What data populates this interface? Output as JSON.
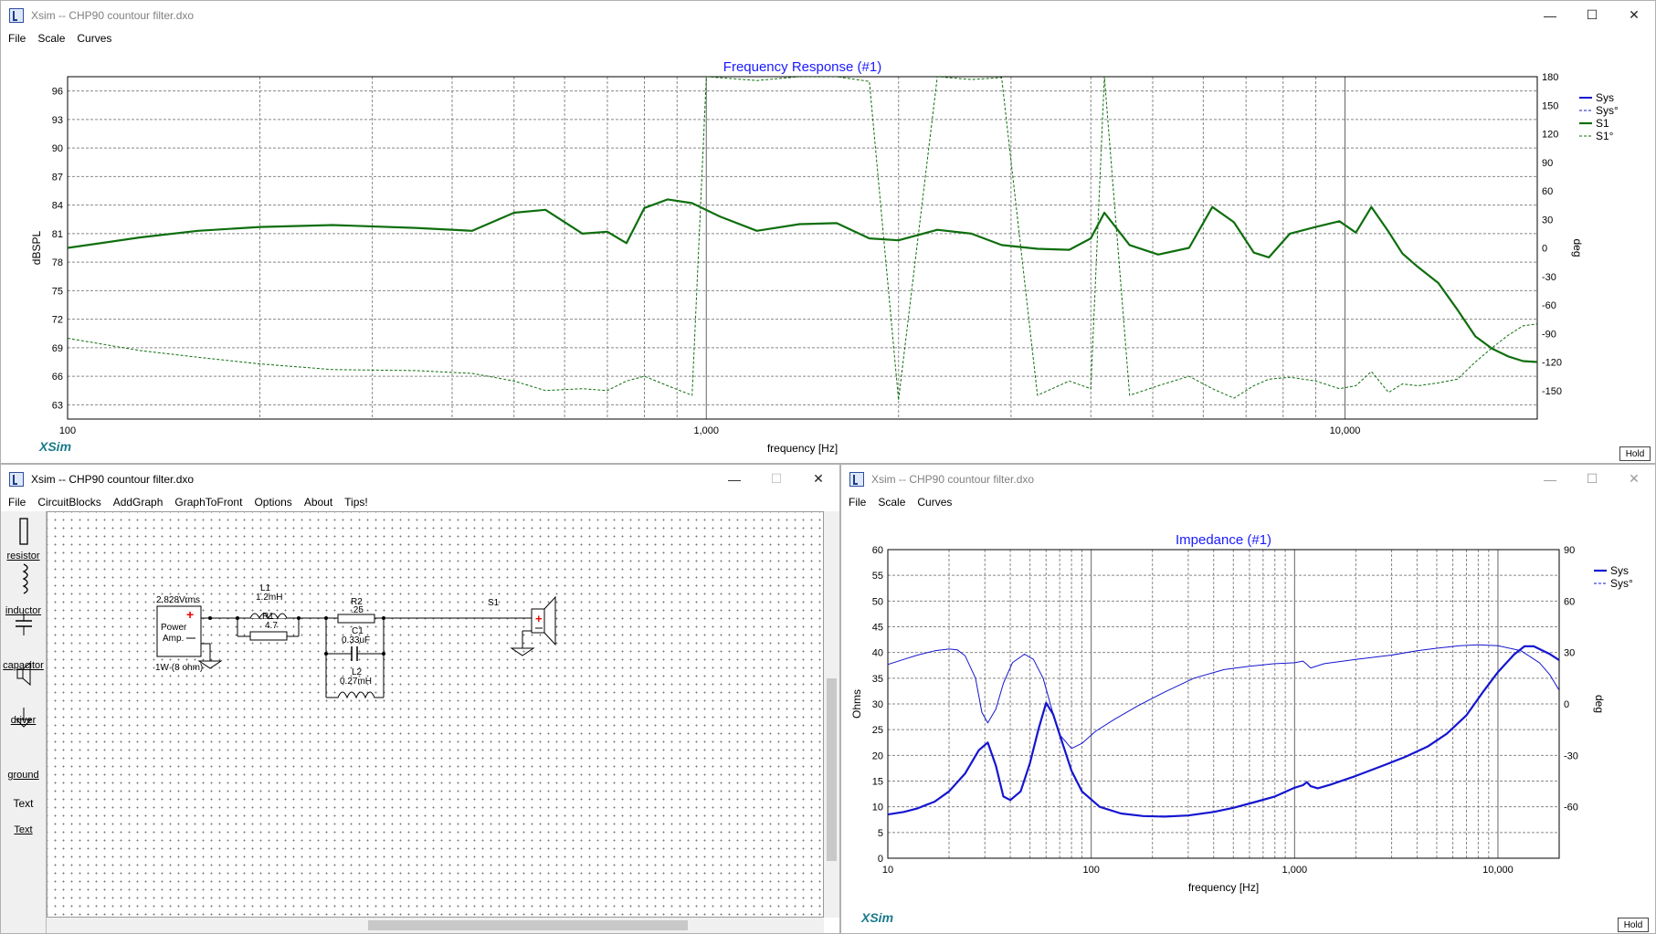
{
  "freq_window": {
    "title": "Xsim -- CHP90 countour filter.dxo",
    "menu": [
      "File",
      "Scale",
      "Curves"
    ],
    "controls": {
      "minimize": "—",
      "maximize": "☐",
      "close": "✕"
    },
    "graph_title": "Frequency Response (#1)",
    "logo": "XSim",
    "hold": "Hold"
  },
  "circuit_window": {
    "title": "Xsim -- CHP90 countour filter.dxo",
    "menu": [
      "File",
      "CircuitBlocks",
      "AddGraph",
      "GraphToFront",
      "Options",
      "About",
      "Tips!"
    ],
    "controls": {
      "minimize": "—",
      "maximize": "☐",
      "close": "✕"
    },
    "tools": [
      "resistor",
      "inductor",
      "capacitor",
      "driver",
      "ground",
      "Text",
      "Text"
    ],
    "components": {
      "source_voltage": "2.828Vrms",
      "source_label_1": "Power",
      "source_label_2": "Amp.",
      "source_power": "1W (8 ohm)",
      "l1_name": "L1",
      "l1_value": "1.2mH",
      "r1_name": "R1",
      "r1_value": "4.7",
      "r2_name": "R2",
      "r2_value": ".25",
      "c1_name": "C1",
      "c1_value": "0.33uF",
      "l2_name": "L2",
      "l2_value": "0.27mH",
      "driver_name": "S1"
    }
  },
  "imp_window": {
    "title": "Xsim -- CHP90 countour filter.dxo",
    "menu": [
      "File",
      "Scale",
      "Curves"
    ],
    "controls": {
      "minimize": "—",
      "maximize": "☐",
      "close": "✕"
    },
    "graph_title": "Impedance (#1)",
    "logo": "XSim",
    "hold": "Hold"
  },
  "colors": {
    "sys": "#1515d0",
    "s1": "#0e6e0e",
    "title": "#1a1aff",
    "logo": "#1a7a8c"
  },
  "chart_data": [
    {
      "type": "line",
      "title": "Frequency Response (#1)",
      "xlabel": "frequency [Hz]",
      "ylabel": "dBSPL",
      "y2label": "deg",
      "xscale": "log",
      "xlim": [
        100,
        20000
      ],
      "ylim": [
        61.5,
        97.5
      ],
      "y2lim": [
        -180,
        180
      ],
      "x_tick_labels": [
        "100",
        "1,000",
        "10,000"
      ],
      "y_ticks": [
        63,
        66,
        69,
        72,
        75,
        78,
        81,
        84,
        87,
        90,
        93,
        96
      ],
      "y2_ticks": [
        -150,
        -120,
        -90,
        -60,
        -30,
        0,
        30,
        60,
        90,
        120,
        150,
        180
      ],
      "grid": true,
      "legend": {
        "position": "right",
        "entries": [
          "Sys",
          "Sys°",
          "S1",
          "S1°"
        ]
      },
      "series": [
        {
          "name": "S1",
          "axis": "left",
          "style": "solid",
          "x": [
            100,
            130,
            160,
            200,
            260,
            350,
            430,
            500,
            560,
            640,
            700,
            750,
            800,
            870,
            950,
            1050,
            1200,
            1400,
            1600,
            1800,
            2000,
            2300,
            2600,
            2900,
            3300,
            3700,
            4000,
            4200,
            4600,
            5100,
            5700,
            6200,
            6700,
            7200,
            7600,
            8200,
            9000,
            9800,
            10400,
            11000,
            11700,
            12300,
            13000,
            14000,
            15000,
            16000,
            17000,
            18000,
            19000,
            20000
          ],
          "y": [
            79.5,
            80.6,
            81.3,
            81.7,
            81.9,
            81.6,
            81.3,
            83.2,
            83.5,
            81.0,
            81.2,
            80.0,
            83.7,
            84.6,
            84.2,
            82.8,
            81.3,
            82.0,
            82.1,
            80.5,
            80.3,
            81.4,
            81.0,
            79.8,
            79.4,
            79.3,
            80.5,
            83.2,
            79.8,
            78.8,
            79.5,
            83.8,
            82.2,
            79.0,
            78.5,
            81.0,
            81.7,
            82.3,
            81.1,
            83.8,
            81.2,
            78.9,
            77.5,
            75.8,
            73.0,
            70.2,
            68.9,
            68.1,
            67.6,
            67.5
          ]
        },
        {
          "name": "S1°",
          "axis": "right",
          "style": "dashed",
          "x": [
            100,
            130,
            160,
            200,
            260,
            350,
            430,
            500,
            560,
            640,
            700,
            750,
            800,
            870,
            950,
            1000,
            1200,
            1400,
            1600,
            1800,
            2000,
            2300,
            2600,
            2900,
            3300,
            3700,
            4000,
            4200,
            4600,
            5100,
            5700,
            6200,
            6700,
            7200,
            7600,
            8200,
            9000,
            9800,
            10400,
            11000,
            11700,
            12300,
            13000,
            14000,
            15000,
            16000,
            17000,
            18000,
            19000,
            20000
          ],
          "y": [
            -95,
            -108,
            -115,
            -122,
            -128,
            -129,
            -132,
            -140,
            -150,
            -148,
            -150,
            -140,
            -135,
            -145,
            -155,
            180,
            176,
            180,
            180,
            175,
            -160,
            180,
            177,
            179,
            -155,
            -140,
            -148,
            180,
            -155,
            -145,
            -135,
            -148,
            -158,
            -145,
            -138,
            -136,
            -140,
            -148,
            -145,
            -130,
            -152,
            -143,
            -145,
            -142,
            -138,
            -120,
            -105,
            -92,
            -82,
            -80
          ]
        }
      ]
    },
    {
      "type": "line",
      "title": "Impedance (#1)",
      "xlabel": "frequency [Hz]",
      "ylabel": "Ohms",
      "y2label": "deg",
      "xscale": "log",
      "xlim": [
        10,
        20000
      ],
      "ylim": [
        0,
        60
      ],
      "y2lim": [
        -90,
        90
      ],
      "x_tick_labels": [
        "10",
        "100",
        "1,000",
        "10,000"
      ],
      "y_ticks": [
        0,
        5,
        10,
        15,
        20,
        25,
        30,
        35,
        40,
        45,
        50,
        55,
        60
      ],
      "y2_ticks": [
        -60,
        -30,
        0,
        30,
        60,
        90
      ],
      "grid": true,
      "legend": {
        "position": "right",
        "entries": [
          "Sys",
          "Sys°"
        ]
      },
      "series": [
        {
          "name": "Sys",
          "axis": "left",
          "style": "solid",
          "x": [
            10,
            12,
            14,
            17,
            20,
            24,
            28,
            31,
            34,
            37,
            40,
            45,
            50,
            55,
            60,
            65,
            70,
            80,
            90,
            110,
            140,
            180,
            230,
            300,
            400,
            500,
            650,
            800,
            1000,
            1100,
            1150,
            1200,
            1300,
            1500,
            2000,
            2800,
            3500,
            4500,
            5600,
            7000,
            8500,
            10000,
            12000,
            13500,
            15000,
            16500,
            18000,
            20000
          ],
          "y": [
            8.5,
            9,
            9.7,
            11,
            13,
            16.5,
            21,
            22.5,
            18,
            12,
            11.3,
            13,
            18.5,
            25,
            30.2,
            28,
            24,
            17,
            13,
            10,
            8.7,
            8.2,
            8.1,
            8.3,
            9,
            9.8,
            11,
            12,
            13.7,
            14.2,
            14.8,
            14,
            13.6,
            14.3,
            16,
            18.2,
            19.7,
            21.7,
            24.2,
            27.8,
            32.5,
            36.2,
            39.6,
            41.2,
            41.2,
            40.4,
            39.7,
            38.5
          ]
        },
        {
          "name": "Sys°",
          "axis": "right",
          "style": "solid-thin",
          "x": [
            10,
            12,
            14,
            17,
            20,
            22,
            24,
            27,
            29,
            31,
            34,
            37,
            41,
            47,
            52,
            58,
            64,
            70,
            80,
            90,
            105,
            130,
            170,
            230,
            320,
            450,
            600,
            800,
            1000,
            1100,
            1150,
            1200,
            1400,
            2000,
            3000,
            4000,
            5000,
            6500,
            8000,
            10000,
            13000,
            16000,
            18000,
            20000
          ],
          "y": [
            23,
            26,
            28.5,
            31,
            32,
            31.5,
            28,
            15,
            -5,
            -11,
            -3,
            12,
            24,
            29,
            26,
            15,
            -3,
            -18,
            -26,
            -23,
            -16,
            -9,
            -1,
            7,
            15,
            20,
            22,
            23.5,
            24,
            25,
            23,
            21,
            23.5,
            26,
            28.5,
            31,
            32.5,
            34,
            34.5,
            34,
            31,
            24,
            17,
            8
          ]
        }
      ]
    }
  ]
}
